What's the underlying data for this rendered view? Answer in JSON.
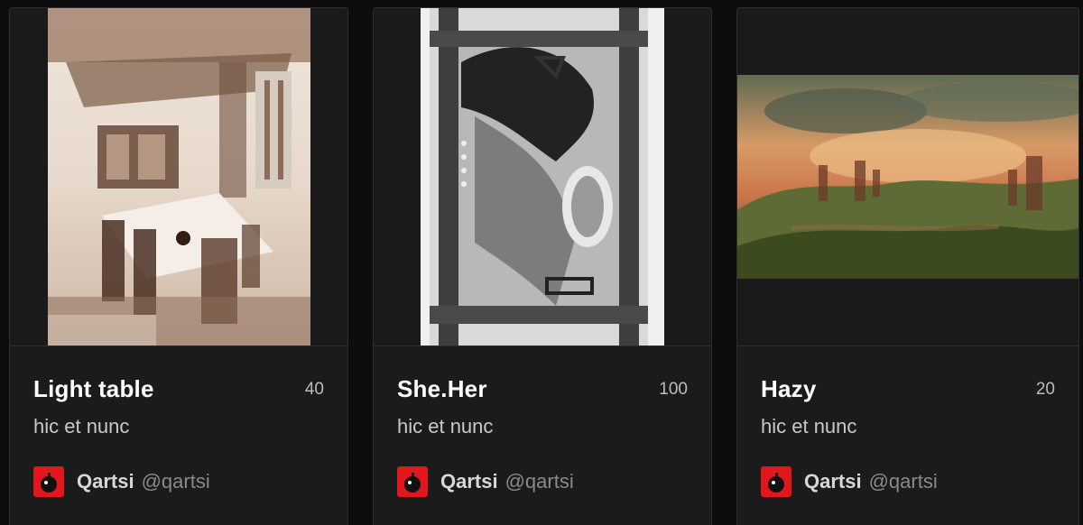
{
  "cards": [
    {
      "title": "Light table",
      "edition": "40",
      "platform": "hic et nunc",
      "creator_name": "Qartsi",
      "creator_handle": "@qartsi"
    },
    {
      "title": "She.Her",
      "edition": "100",
      "platform": "hic et nunc",
      "creator_name": "Qartsi",
      "creator_handle": "@qartsi"
    },
    {
      "title": "Hazy",
      "edition": "20",
      "platform": "hic et nunc",
      "creator_name": "Qartsi",
      "creator_handle": "@qartsi"
    }
  ],
  "colors": {
    "card_bg": "#1b1b1b",
    "page_bg": "#0d0d0d",
    "avatar_red": "#e2171c",
    "title": "#ffffff"
  },
  "icons": {
    "avatar": "bomb-avatar-icon"
  }
}
